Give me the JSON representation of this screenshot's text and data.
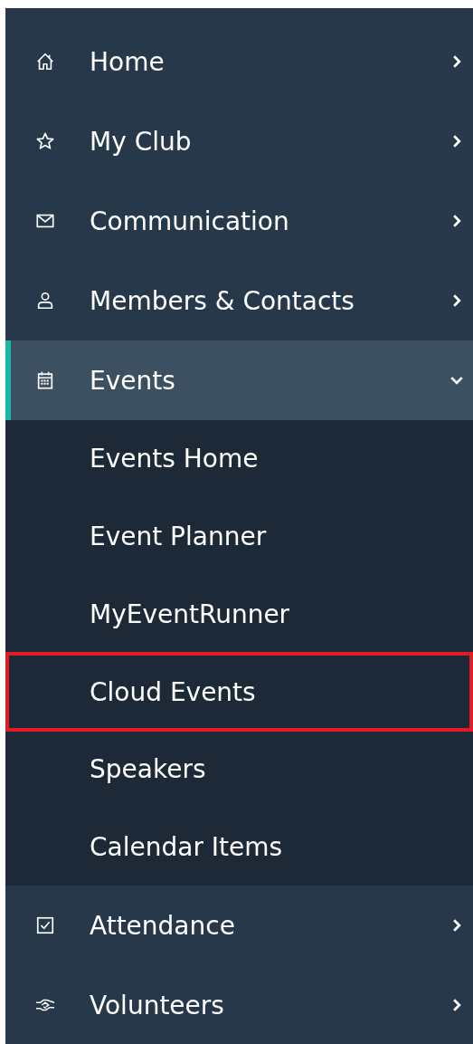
{
  "sidebar": {
    "items": [
      {
        "label": "Home",
        "selected": false,
        "expanded": false
      },
      {
        "label": "My Club",
        "selected": false,
        "expanded": false
      },
      {
        "label": "Communication",
        "selected": false,
        "expanded": false
      },
      {
        "label": "Members & Contacts",
        "selected": false,
        "expanded": false
      },
      {
        "label": "Events",
        "selected": true,
        "expanded": true,
        "children": [
          {
            "label": "Events Home",
            "highlighted": false
          },
          {
            "label": "Event Planner",
            "highlighted": false
          },
          {
            "label": "MyEventRunner",
            "highlighted": false
          },
          {
            "label": "Cloud Events",
            "highlighted": true
          },
          {
            "label": "Speakers",
            "highlighted": false
          },
          {
            "label": "Calendar Items",
            "highlighted": false
          }
        ]
      },
      {
        "label": "Attendance",
        "selected": false,
        "expanded": false
      },
      {
        "label": "Volunteers",
        "selected": false,
        "expanded": false
      }
    ]
  }
}
